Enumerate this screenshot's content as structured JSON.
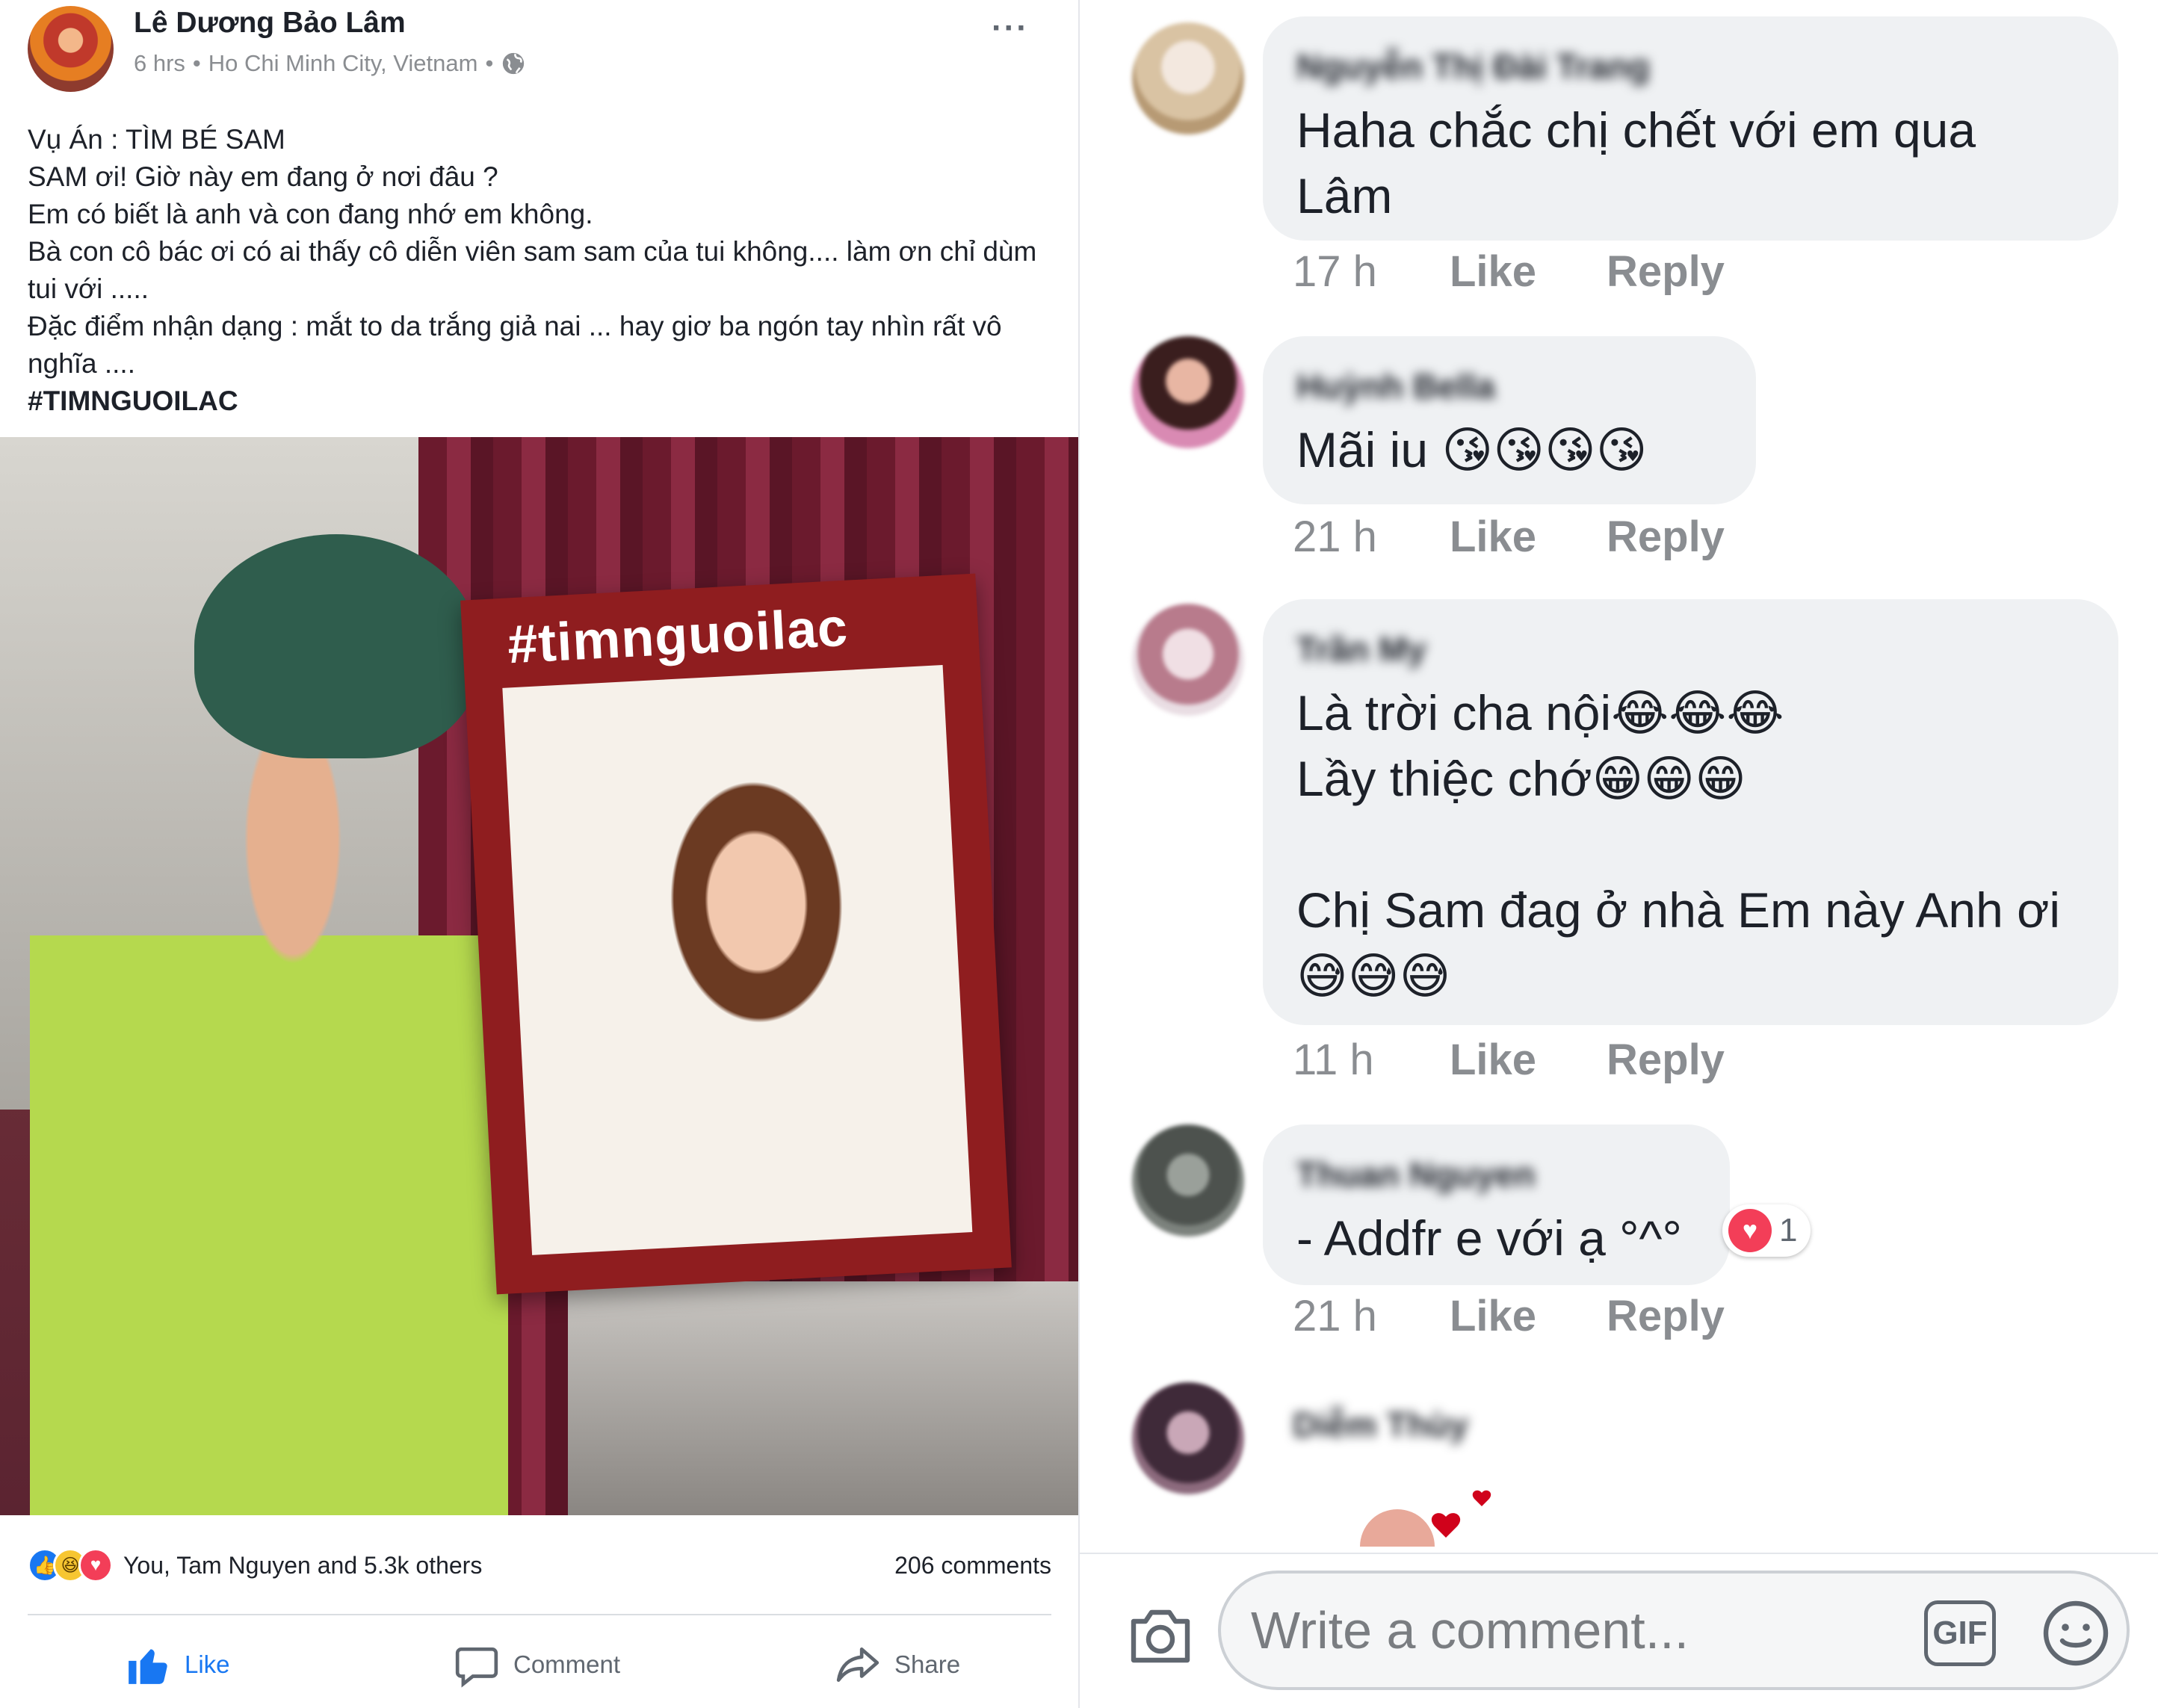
{
  "post": {
    "author": "Lê Dương Bảo Lâm",
    "time": "6 hrs",
    "location": "Ho Chi Minh City, Vietnam",
    "separator": "•",
    "more": "···",
    "text_lines": [
      "Vụ Án : TÌM BÉ SAM",
      "SAM ơi! Giờ này em đang ở nơi đâu ?",
      "Em có biết là anh và con đang nhớ em không.",
      "Bà con cô bác ơi có ai thấy cô diễn viên sam sam  của tui không.... làm ơn chỉ dùm tui với .....",
      "Đặc điểm nhận dạng : mắt to da trắng giả nai ... hay giơ ba ngón tay nhìn rất vô nghĩa ...."
    ],
    "hashtag": "#TIMNGUOILAC",
    "image_frame_text": "#timnguoilac",
    "reactions_text": "You, Tam Nguyen and 5.3k others",
    "comments_count": "206 comments",
    "actions": {
      "like": "Like",
      "comment": "Comment",
      "share": "Share"
    },
    "colors": {
      "accent": "#1877f2",
      "love": "#f33e58",
      "haha": "#f7c631"
    }
  },
  "comments": [
    {
      "name": "Nguyễn Thị Đài Trang",
      "text": "Haha chắc chị chết với em qua\nLâm",
      "time": "17 h",
      "like": "Like",
      "reply": "Reply"
    },
    {
      "name": "Huỳnh Bella",
      "text": "Mãi iu 😘😘😘😘",
      "time": "21 h",
      "like": "Like",
      "reply": "Reply"
    },
    {
      "name": "Trần My",
      "text": "Là trời cha nội😂😂😂\nLầy thiệc chớ😁😁😁\n\nChị Sam đag ở nhà Em này Anh ơi\n😅😅😅",
      "time": "11 h",
      "like": "Like",
      "reply": "Reply"
    },
    {
      "name": "Thuan Nguyen",
      "text": "- Addfr e với ạ °^°",
      "time": "21 h",
      "like": "Like",
      "reply": "Reply",
      "reaction_count": "1"
    },
    {
      "name": "Diễm Thùy"
    }
  ],
  "composer": {
    "placeholder": "Write a comment...",
    "gif": "GIF"
  }
}
